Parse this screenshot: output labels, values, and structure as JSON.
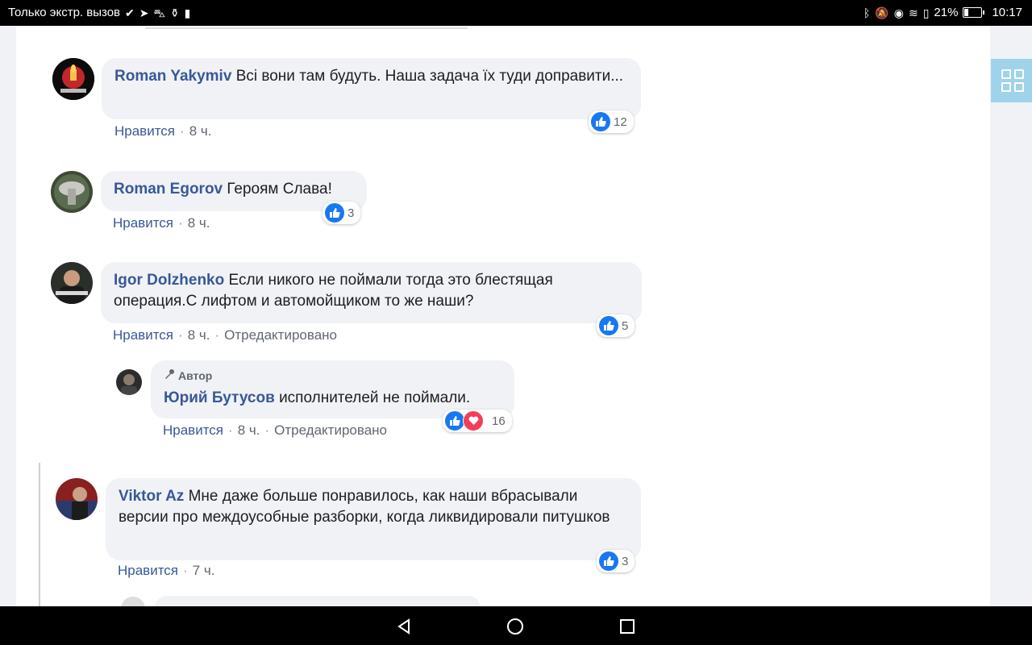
{
  "status_bar": {
    "left_text": "Только экстр. вызов",
    "battery_percent": "21%",
    "battery_level": 0.21,
    "time": "10:17",
    "left_icons": [
      "check-icon",
      "telegram-icon",
      "car-icon",
      "app-icon",
      "sim-icon"
    ],
    "right_icons": [
      "bluetooth-icon",
      "mute-icon",
      "eye-icon",
      "wifi-icon",
      "battery-save-icon"
    ]
  },
  "comments": [
    {
      "author": "Roman Yakymiv",
      "text": "Всі вони там будуть. Наша задача їх туди доправити...",
      "like_label": "Нравится",
      "time": "8 ч.",
      "reactions_count": "12"
    },
    {
      "author": "Roman Egorov",
      "text": "Героям Слава!",
      "like_label": "Нравится",
      "time": "8 ч.",
      "reactions_count": "3"
    },
    {
      "author": "Igor Dolzhenko",
      "text": "Если никого не поймали тогда это блестящая операция.С лифтом и автомойщиком то же наши?",
      "like_label": "Нравится",
      "time": "8 ч.",
      "edited_label": "Отредактировано",
      "reactions_count": "5"
    },
    {
      "badge": "Автор",
      "author": "Юрий Бутусов",
      "text": "исполнителей не поймали.",
      "like_label": "Нравится",
      "time": "8 ч.",
      "edited_label": "Отредактировано",
      "reactions_count": "16"
    },
    {
      "author": "Viktor Az",
      "text": "Мне даже больше понравилось, как наши вбрасывали версии про междоусобные разборки, когда ликвидировали питушков",
      "like_label": "Нравится",
      "time": "7 ч.",
      "reactions_count": "3"
    }
  ],
  "colors": {
    "author_link": "#385898",
    "bubble_bg": "#f0f2f5",
    "like_blue": "#1877f2",
    "love_red": "#f33e58",
    "grid_button": "#9fd3ec"
  }
}
